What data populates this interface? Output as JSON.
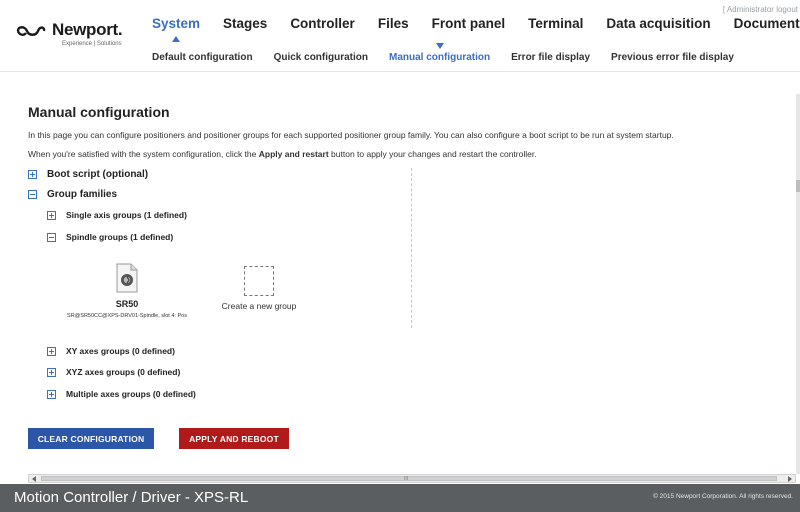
{
  "header": {
    "admin_link": "[ Administrator logout",
    "logo": {
      "name": "Newport.",
      "tagline": "Experience | Solutions"
    },
    "main_nav": [
      "System",
      "Stages",
      "Controller",
      "Files",
      "Front panel",
      "Terminal",
      "Data acquisition",
      "Documentation"
    ],
    "main_nav_active": "System",
    "sub_nav": [
      "Default configuration",
      "Quick configuration",
      "Manual configuration",
      "Error file display",
      "Previous error file display"
    ],
    "sub_nav_active": "Manual configuration"
  },
  "page": {
    "title": "Manual configuration",
    "intro": "In this page you can configure positioners and positioner groups for each supported positioner group family. You can also configure a boot script to be run at system startup.",
    "instruction_prefix": "When you're satisfied with the system configuration, click the ",
    "instruction_bold": "Apply and restart",
    "instruction_suffix": " button to apply your changes and restart the controller."
  },
  "tree": {
    "boot_script": "Boot script (optional)",
    "group_families": "Group families",
    "single_axis": "Single axis groups (1 defined)",
    "spindle": "Spindle groups (1 defined)",
    "xy_axes": "XY axes groups (0 defined)",
    "xyz_axes": "XYZ axes groups (0 defined)",
    "multiple_axes": "Multiple axes groups (0 defined)"
  },
  "spindle_group": {
    "name": "SR50",
    "description": "SR@SR50CC@XPS-DRV01-Spindle, slot 4: Pos",
    "new_group_label": "Create a new group"
  },
  "buttons": {
    "clear": "CLEAR CONFIGURATION",
    "apply": "APPLY AND REBOOT"
  },
  "scrollbar": {
    "grip": "III"
  },
  "footer": {
    "title": "Motion Controller / Driver - XPS-RL",
    "copyright": "© 2015 Newport Corporation. All rights reserved."
  },
  "colors": {
    "accent": "#3a6fc1",
    "clear_button": "#2c57a8",
    "apply_button": "#b01a1a",
    "footer": "#5b5e60"
  }
}
